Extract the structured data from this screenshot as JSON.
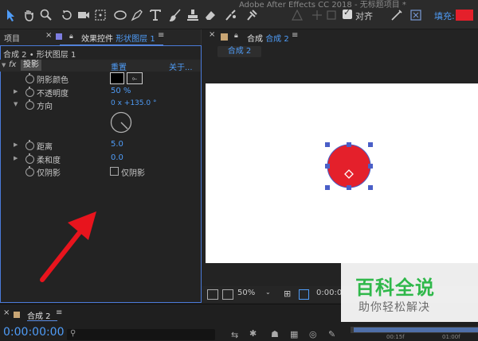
{
  "window": {
    "title": "Adobe After Effects CC 2018 - 无标题项目 *"
  },
  "toolbar": {
    "align_label": "对齐",
    "align_checked": true,
    "fill_label": "填充:",
    "fill_color": "#e4202b"
  },
  "left_panel": {
    "project_tab": "项目",
    "effect_controls_tab_prefix": "效果控件",
    "effect_controls_layer": "形状图层 1",
    "layer_path": "合成 2 • 形状图层 1",
    "effect": {
      "fx": "fx",
      "name": "投影",
      "reset": "重置",
      "about": "关于..."
    },
    "properties": [
      {
        "name": "阴影颜色",
        "value": ""
      },
      {
        "name": "不透明度",
        "value": "50 %"
      },
      {
        "name": "方向",
        "value": "0 x +135.0 °"
      },
      {
        "name": "距离",
        "value": "5.0"
      },
      {
        "name": "柔和度",
        "value": "0.0"
      },
      {
        "name": "仅阴影",
        "value": "仅阴影"
      }
    ],
    "shadow_color": "#000000"
  },
  "comp_panel": {
    "tab_prefix": "合成",
    "tab_name": "合成 2",
    "comp_label": "合成 2",
    "zoom": "50%",
    "time": "0:00:0",
    "shape_fill": "#e4202b",
    "handle_color": "#4a5fc7"
  },
  "timeline": {
    "tab": "合成 2",
    "timecode": "0:00:00:00",
    "time_marks": [
      "00:15f",
      "01:00f"
    ]
  },
  "watermark": {
    "main": "百科全说",
    "sub": "助你轻松解决"
  }
}
